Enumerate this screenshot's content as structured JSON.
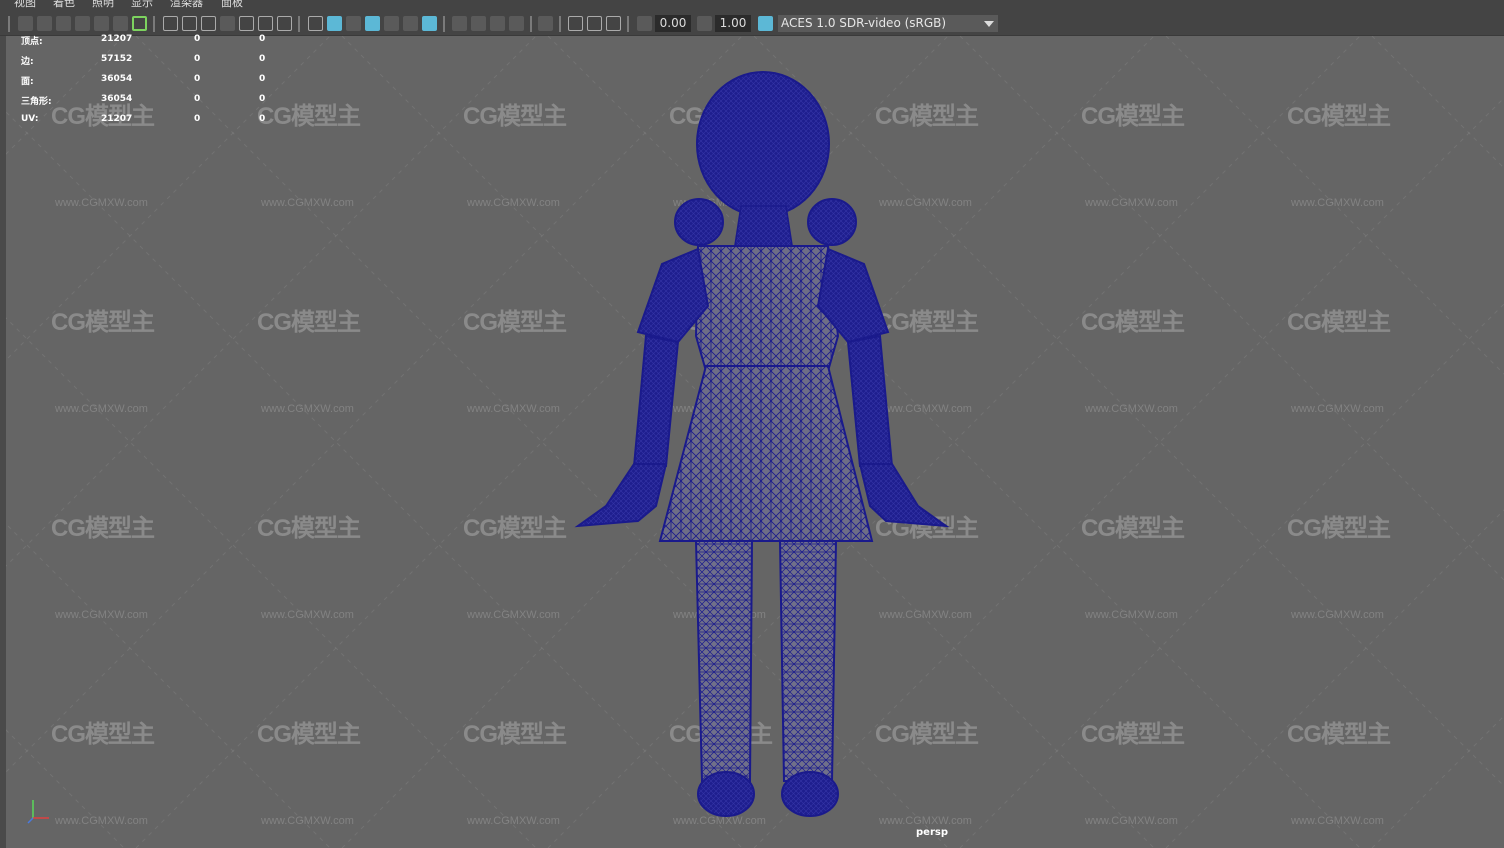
{
  "menubar": {
    "items": [
      "视图",
      "着色",
      "照明",
      "显示",
      "渲染器",
      "面板"
    ]
  },
  "toolbar": {
    "exposure_value": "0.00",
    "gamma_value": "1.00",
    "color_space": "ACES 1.0 SDR-video (sRGB)"
  },
  "stats": {
    "rows": [
      {
        "label": "顶点:",
        "total": "21207",
        "selected": "0",
        "extra": "0"
      },
      {
        "label": "边:",
        "total": "57152",
        "selected": "0",
        "extra": "0"
      },
      {
        "label": "面:",
        "total": "36054",
        "selected": "0",
        "extra": "0"
      },
      {
        "label": "三角形:",
        "total": "36054",
        "selected": "0",
        "extra": "0"
      },
      {
        "label": "UV:",
        "total": "21207",
        "selected": "0",
        "extra": "0"
      }
    ]
  },
  "watermark": {
    "logo": "CG模型主",
    "url": "www.CGMXW.com"
  },
  "viewport": {
    "camera": "persp",
    "wireframe_color": "#1a1a8c"
  },
  "axis_labels": {
    "x": "x",
    "y": "y",
    "z": "z"
  }
}
